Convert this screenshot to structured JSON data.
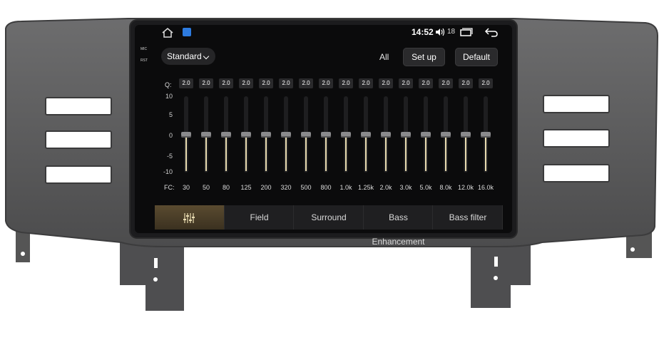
{
  "status_bar": {
    "time": "14:52",
    "volume": "18"
  },
  "side_labels": {
    "mic": "MIC",
    "rst": "RST"
  },
  "toolbar": {
    "preset": "Standard",
    "all_label": "All",
    "setup_label": "Set up",
    "default_label": "Default"
  },
  "equalizer": {
    "q_label": "Q:",
    "fc_label": "FC:",
    "scale": [
      "10",
      "5",
      "0",
      "-5",
      "-10"
    ],
    "bands": [
      {
        "q": "2.0",
        "freq": "30",
        "gain": 0
      },
      {
        "q": "2.0",
        "freq": "50",
        "gain": 0
      },
      {
        "q": "2.0",
        "freq": "80",
        "gain": 0
      },
      {
        "q": "2.0",
        "freq": "125",
        "gain": 0
      },
      {
        "q": "2.0",
        "freq": "200",
        "gain": 0
      },
      {
        "q": "2.0",
        "freq": "320",
        "gain": 0
      },
      {
        "q": "2.0",
        "freq": "500",
        "gain": 0
      },
      {
        "q": "2.0",
        "freq": "800",
        "gain": 0
      },
      {
        "q": "2.0",
        "freq": "1.0k",
        "gain": 0
      },
      {
        "q": "2.0",
        "freq": "1.25k",
        "gain": 0
      },
      {
        "q": "2.0",
        "freq": "2.0k",
        "gain": 0
      },
      {
        "q": "2.0",
        "freq": "3.0k",
        "gain": 0
      },
      {
        "q": "2.0",
        "freq": "5.0k",
        "gain": 0
      },
      {
        "q": "2.0",
        "freq": "8.0k",
        "gain": 0
      },
      {
        "q": "2.0",
        "freq": "12.0k",
        "gain": 0
      },
      {
        "q": "2.0",
        "freq": "16.0k",
        "gain": 0
      }
    ]
  },
  "tabs": [
    {
      "label": "",
      "icon": "equalizer-icon",
      "active": true
    },
    {
      "label": "Field"
    },
    {
      "label": "Surround"
    },
    {
      "label": "Bass Enhancement"
    },
    {
      "label": "Bass filter"
    }
  ],
  "colors": {
    "accent": "#e9dcb1",
    "active_tab": "#5a4b30",
    "screen_bg": "#0b0b0c",
    "bezel": "#5e5e5f"
  }
}
